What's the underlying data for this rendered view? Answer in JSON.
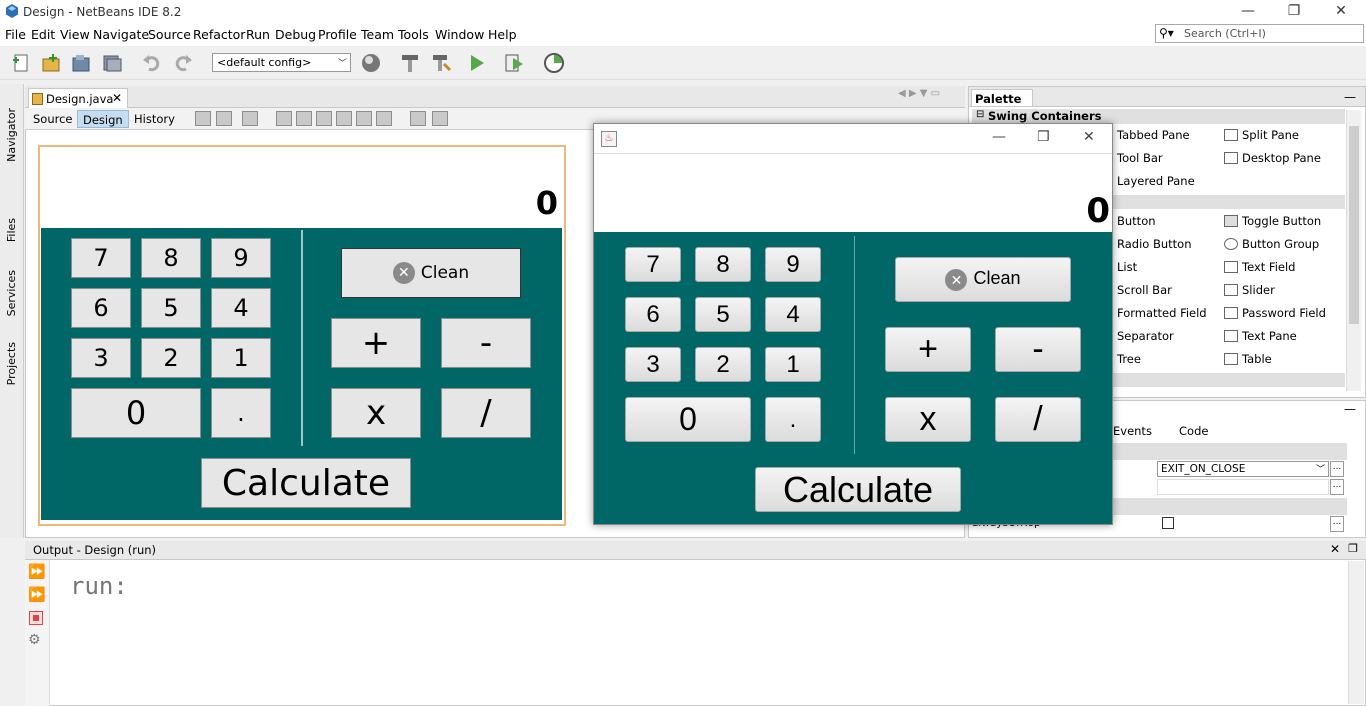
{
  "window": {
    "title": "Design - NetBeans IDE 8.2",
    "minimize": "—",
    "maximize": "❐",
    "close": "✕"
  },
  "menu": [
    "File",
    "Edit",
    "View",
    "Navigate",
    "Source",
    "Refactor",
    "Run",
    "Debug",
    "Profile",
    "Team",
    "Tools",
    "Window",
    "Help"
  ],
  "search": {
    "placeholder": "Search (Ctrl+I)"
  },
  "toolbar": {
    "config": "<default config>"
  },
  "sidebar": {
    "navigator": "Navigator",
    "files": "Files",
    "services": "Services",
    "projects": "Projects"
  },
  "editor": {
    "file_tab": "Design.java",
    "tabs": [
      "Source",
      "Design",
      "History"
    ],
    "active_tab": "Design"
  },
  "calculator": {
    "display": "0",
    "digits": [
      "7",
      "8",
      "9",
      "6",
      "5",
      "4",
      "3",
      "2",
      "1"
    ],
    "zero": "0",
    "dot": ".",
    "clean": "Clean",
    "plus": "+",
    "minus": "-",
    "times": "x",
    "divide": "/",
    "calculate": "Calculate"
  },
  "palette": {
    "title": "Palette",
    "section1": "Swing Containers",
    "containers": [
      "Tabbed Pane",
      "Split Pane",
      "Tool Bar",
      "Desktop Pane",
      "Layered Pane"
    ],
    "controls": [
      "Button",
      "Toggle Button",
      "Radio Button",
      "Button Group",
      "List",
      "Text Field",
      "Scroll Bar",
      "Slider",
      "Formatted Field",
      "Password Field",
      "Separator",
      "Text Pane",
      "Tree",
      "Table"
    ]
  },
  "properties": {
    "tabs": [
      "Events",
      "Code"
    ],
    "default_close": "EXIT_ON_CLOSE",
    "always_on_top": "alwaysOnTop",
    "ellipsis": "..."
  },
  "output": {
    "title": "Output - Design (run)",
    "text": "run:"
  },
  "colors": {
    "calc_bg": "#006666",
    "display_bg": "#ffffff",
    "selected_tab": "#c5ddf0"
  }
}
